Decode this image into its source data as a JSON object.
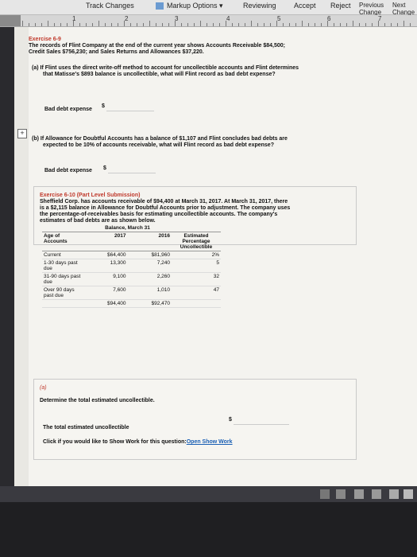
{
  "toolbar": {
    "track_changes": "Track Changes",
    "markup_options": "Markup Options",
    "reviewing": "Reviewing",
    "accept": "Accept",
    "reject": "Reject",
    "previous_change": "Previous Change",
    "next_change": "Next Change"
  },
  "ruler": {
    "marks": [
      "1",
      "2",
      "3",
      "4",
      "5",
      "6",
      "7"
    ]
  },
  "ex69": {
    "title": "Exercise 6-9",
    "desc1": "The records of Flint Company at the end of the current year shows Accounts Receivable $84,500;",
    "desc2": "Credit Sales $756,230; and Sales Returns and Allowances $37,220.",
    "qa1": "(a)  If Flint uses the direct write-off method to account for uncollectible accounts and Flint determines",
    "qa2": "that Matisse's $893 balance is uncollectible, what will Flint record as bad debt expense?",
    "bad_debt_label": "Bad debt expense",
    "dollar": "$",
    "qb1": "(b)  If Allowance for Doubtful Accounts has a balance of $1,107 and Flint concludes bad debts are",
    "qb2": "expected to be 10% of accounts receivable, what will Flint record as bad debt expense?"
  },
  "ex610": {
    "title": "Exercise 6-10 (Part Level Submission)",
    "desc1": "Sheffield Corp. has accounts receivable of $94,400 at March 31, 2017. At March 31, 2017, there",
    "desc2": "is a $2,115 balance in Allowance for Doubtful Accounts prior to adjustment. The company uses",
    "desc3": "the percentage-of-receivables basis for estimating uncollectible accounts. The company's",
    "desc4": "estimates of bad debts are as shown below.",
    "table": {
      "hdr_balance": "Balance, March 31",
      "hdr_age": "Age of Accounts",
      "hdr_2017": "2017",
      "hdr_2016": "2016",
      "hdr_est": "Estimated Percentage Uncollectible",
      "rows": [
        {
          "age": "Current",
          "y2017": "$64,400",
          "y2016": "$81,960",
          "pct": "2%"
        },
        {
          "age": "1-30 days past due",
          "y2017": "13,300",
          "y2016": "7,240",
          "pct": "5"
        },
        {
          "age": "31-90 days past due",
          "y2017": "9,100",
          "y2016": "2,260",
          "pct": "32"
        },
        {
          "age": "Over 90 days past due",
          "y2017": "7,600",
          "y2016": "1,010",
          "pct": "47"
        }
      ],
      "total_2017": "$94,400",
      "total_2016": "$92,470"
    },
    "part_a": "(a)",
    "instruction": "Determine the total estimated uncollectible.",
    "total_label": "The total estimated uncollectible",
    "dollar": "$",
    "show_work": "Click if you would like to Show Work for this question:",
    "show_work_link": "Open Show Work"
  }
}
